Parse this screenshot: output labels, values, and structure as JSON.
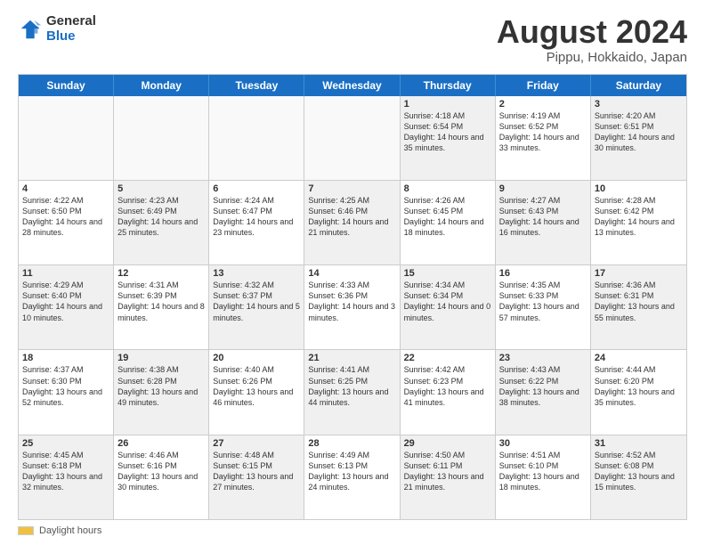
{
  "logo": {
    "general": "General",
    "blue": "Blue"
  },
  "title": "August 2024",
  "subtitle": "Pippu, Hokkaido, Japan",
  "days_of_week": [
    "Sunday",
    "Monday",
    "Tuesday",
    "Wednesday",
    "Thursday",
    "Friday",
    "Saturday"
  ],
  "footer": {
    "daylight_label": "Daylight hours"
  },
  "weeks": [
    [
      {
        "day": "",
        "text": "",
        "empty": true
      },
      {
        "day": "",
        "text": "",
        "empty": true
      },
      {
        "day": "",
        "text": "",
        "empty": true
      },
      {
        "day": "",
        "text": "",
        "empty": true
      },
      {
        "day": "1",
        "text": "Sunrise: 4:18 AM\nSunset: 6:54 PM\nDaylight: 14 hours\nand 35 minutes.",
        "shaded": true
      },
      {
        "day": "2",
        "text": "Sunrise: 4:19 AM\nSunset: 6:52 PM\nDaylight: 14 hours\nand 33 minutes.",
        "shaded": false
      },
      {
        "day": "3",
        "text": "Sunrise: 4:20 AM\nSunset: 6:51 PM\nDaylight: 14 hours\nand 30 minutes.",
        "shaded": true
      }
    ],
    [
      {
        "day": "4",
        "text": "Sunrise: 4:22 AM\nSunset: 6:50 PM\nDaylight: 14 hours\nand 28 minutes.",
        "shaded": false
      },
      {
        "day": "5",
        "text": "Sunrise: 4:23 AM\nSunset: 6:49 PM\nDaylight: 14 hours\nand 25 minutes.",
        "shaded": true
      },
      {
        "day": "6",
        "text": "Sunrise: 4:24 AM\nSunset: 6:47 PM\nDaylight: 14 hours\nand 23 minutes.",
        "shaded": false
      },
      {
        "day": "7",
        "text": "Sunrise: 4:25 AM\nSunset: 6:46 PM\nDaylight: 14 hours\nand 21 minutes.",
        "shaded": true
      },
      {
        "day": "8",
        "text": "Sunrise: 4:26 AM\nSunset: 6:45 PM\nDaylight: 14 hours\nand 18 minutes.",
        "shaded": false
      },
      {
        "day": "9",
        "text": "Sunrise: 4:27 AM\nSunset: 6:43 PM\nDaylight: 14 hours\nand 16 minutes.",
        "shaded": true
      },
      {
        "day": "10",
        "text": "Sunrise: 4:28 AM\nSunset: 6:42 PM\nDaylight: 14 hours\nand 13 minutes.",
        "shaded": false
      }
    ],
    [
      {
        "day": "11",
        "text": "Sunrise: 4:29 AM\nSunset: 6:40 PM\nDaylight: 14 hours\nand 10 minutes.",
        "shaded": true
      },
      {
        "day": "12",
        "text": "Sunrise: 4:31 AM\nSunset: 6:39 PM\nDaylight: 14 hours\nand 8 minutes.",
        "shaded": false
      },
      {
        "day": "13",
        "text": "Sunrise: 4:32 AM\nSunset: 6:37 PM\nDaylight: 14 hours\nand 5 minutes.",
        "shaded": true
      },
      {
        "day": "14",
        "text": "Sunrise: 4:33 AM\nSunset: 6:36 PM\nDaylight: 14 hours\nand 3 minutes.",
        "shaded": false
      },
      {
        "day": "15",
        "text": "Sunrise: 4:34 AM\nSunset: 6:34 PM\nDaylight: 14 hours\nand 0 minutes.",
        "shaded": true
      },
      {
        "day": "16",
        "text": "Sunrise: 4:35 AM\nSunset: 6:33 PM\nDaylight: 13 hours\nand 57 minutes.",
        "shaded": false
      },
      {
        "day": "17",
        "text": "Sunrise: 4:36 AM\nSunset: 6:31 PM\nDaylight: 13 hours\nand 55 minutes.",
        "shaded": true
      }
    ],
    [
      {
        "day": "18",
        "text": "Sunrise: 4:37 AM\nSunset: 6:30 PM\nDaylight: 13 hours\nand 52 minutes.",
        "shaded": false
      },
      {
        "day": "19",
        "text": "Sunrise: 4:38 AM\nSunset: 6:28 PM\nDaylight: 13 hours\nand 49 minutes.",
        "shaded": true
      },
      {
        "day": "20",
        "text": "Sunrise: 4:40 AM\nSunset: 6:26 PM\nDaylight: 13 hours\nand 46 minutes.",
        "shaded": false
      },
      {
        "day": "21",
        "text": "Sunrise: 4:41 AM\nSunset: 6:25 PM\nDaylight: 13 hours\nand 44 minutes.",
        "shaded": true
      },
      {
        "day": "22",
        "text": "Sunrise: 4:42 AM\nSunset: 6:23 PM\nDaylight: 13 hours\nand 41 minutes.",
        "shaded": false
      },
      {
        "day": "23",
        "text": "Sunrise: 4:43 AM\nSunset: 6:22 PM\nDaylight: 13 hours\nand 38 minutes.",
        "shaded": true
      },
      {
        "day": "24",
        "text": "Sunrise: 4:44 AM\nSunset: 6:20 PM\nDaylight: 13 hours\nand 35 minutes.",
        "shaded": false
      }
    ],
    [
      {
        "day": "25",
        "text": "Sunrise: 4:45 AM\nSunset: 6:18 PM\nDaylight: 13 hours\nand 32 minutes.",
        "shaded": true
      },
      {
        "day": "26",
        "text": "Sunrise: 4:46 AM\nSunset: 6:16 PM\nDaylight: 13 hours\nand 30 minutes.",
        "shaded": false
      },
      {
        "day": "27",
        "text": "Sunrise: 4:48 AM\nSunset: 6:15 PM\nDaylight: 13 hours\nand 27 minutes.",
        "shaded": true
      },
      {
        "day": "28",
        "text": "Sunrise: 4:49 AM\nSunset: 6:13 PM\nDaylight: 13 hours\nand 24 minutes.",
        "shaded": false
      },
      {
        "day": "29",
        "text": "Sunrise: 4:50 AM\nSunset: 6:11 PM\nDaylight: 13 hours\nand 21 minutes.",
        "shaded": true
      },
      {
        "day": "30",
        "text": "Sunrise: 4:51 AM\nSunset: 6:10 PM\nDaylight: 13 hours\nand 18 minutes.",
        "shaded": false
      },
      {
        "day": "31",
        "text": "Sunrise: 4:52 AM\nSunset: 6:08 PM\nDaylight: 13 hours\nand 15 minutes.",
        "shaded": true
      }
    ]
  ]
}
